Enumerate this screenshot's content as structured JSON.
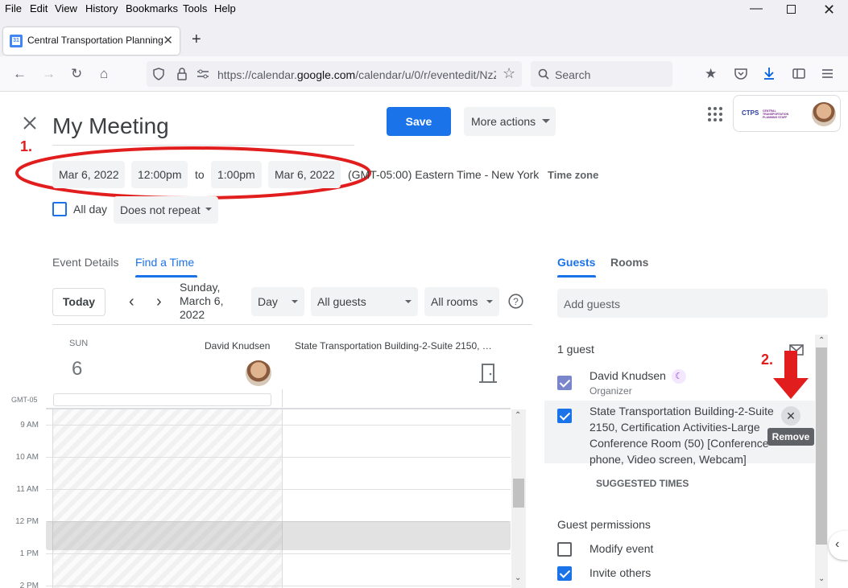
{
  "menubar": {
    "items": [
      "File",
      "Edit",
      "View",
      "History",
      "Bookmarks",
      "Tools",
      "Help"
    ]
  },
  "browser": {
    "tab_title": "Central Transportation Planning Staff",
    "url_prefix": "https://calendar.",
    "url_domain": "google.com",
    "url_rest": "/calendar/u/0/r/eventedit/NzZ",
    "search_placeholder": "Search"
  },
  "event": {
    "title": "My Meeting",
    "save_label": "Save",
    "more_actions_label": "More actions",
    "start_date": "Mar 6, 2022",
    "start_time": "12:00pm",
    "to_label": "to",
    "end_time": "1:00pm",
    "end_date": "Mar 6, 2022",
    "timezone_text": "(GMT-05:00) Eastern Time - New York",
    "timezone_link": "Time zone",
    "all_day_label": "All day",
    "repeat_label": "Does not repeat"
  },
  "annotations": {
    "step1": "1.",
    "step2": "2."
  },
  "details_tabs": {
    "event_details": "Event Details",
    "find_a_time": "Find a Time"
  },
  "find_time": {
    "today_label": "Today",
    "date_line1": "Sunday,",
    "date_line2": "March 6,",
    "date_line3": "2022",
    "view_select": "Day",
    "guests_select": "All guests",
    "rooms_select": "All rooms",
    "day_abbr": "SUN",
    "day_num": "6",
    "person_col": "David Knudsen",
    "room_col": "State Transportation Building-2-Suite 2150, …",
    "tz_label": "GMT-05",
    "hours": [
      "9 AM",
      "10 AM",
      "11 AM",
      "12 PM",
      "1 PM",
      "2 PM"
    ]
  },
  "guests_panel": {
    "tab_guests": "Guests",
    "tab_rooms": "Rooms",
    "add_placeholder": "Add guests",
    "count": "1 guest",
    "guest_name": "David Knudsen",
    "guest_role": "Organizer",
    "room_line1": "State Transportation Building-2-Suite",
    "room_line2": "2150, Certification Activities-Large",
    "room_line3": "Conference Room (50) [Conference",
    "room_line4": "phone, Video screen, Webcam]",
    "remove_tooltip": "Remove",
    "suggested_times": "SUGGESTED TIMES",
    "permissions_title": "Guest permissions",
    "perm_modify": "Modify event",
    "perm_invite": "Invite others"
  },
  "account": {
    "org_text": "CENTRAL TRANSPORTATION PLANNING STAFF",
    "org_abbr": "CTPS"
  },
  "icons": [
    "back-icon",
    "forward-icon",
    "reload-icon",
    "home-icon",
    "shield-icon",
    "lock-icon",
    "permissions-icon",
    "bookmark-star-icon",
    "search-icon",
    "pocket-icon",
    "download-icon",
    "sidebar-icon",
    "hamburger-menu-icon",
    "close-icon",
    "apps-grid-icon",
    "help-icon",
    "email-icon",
    "dnd-moon-icon",
    "door-icon",
    "red-arrow-icon"
  ],
  "colors": {
    "accent": "#1a73e8",
    "annotation_red": "#e21d1d",
    "guest_check": "#7986cb",
    "dnd_purple": "#9334e6"
  }
}
